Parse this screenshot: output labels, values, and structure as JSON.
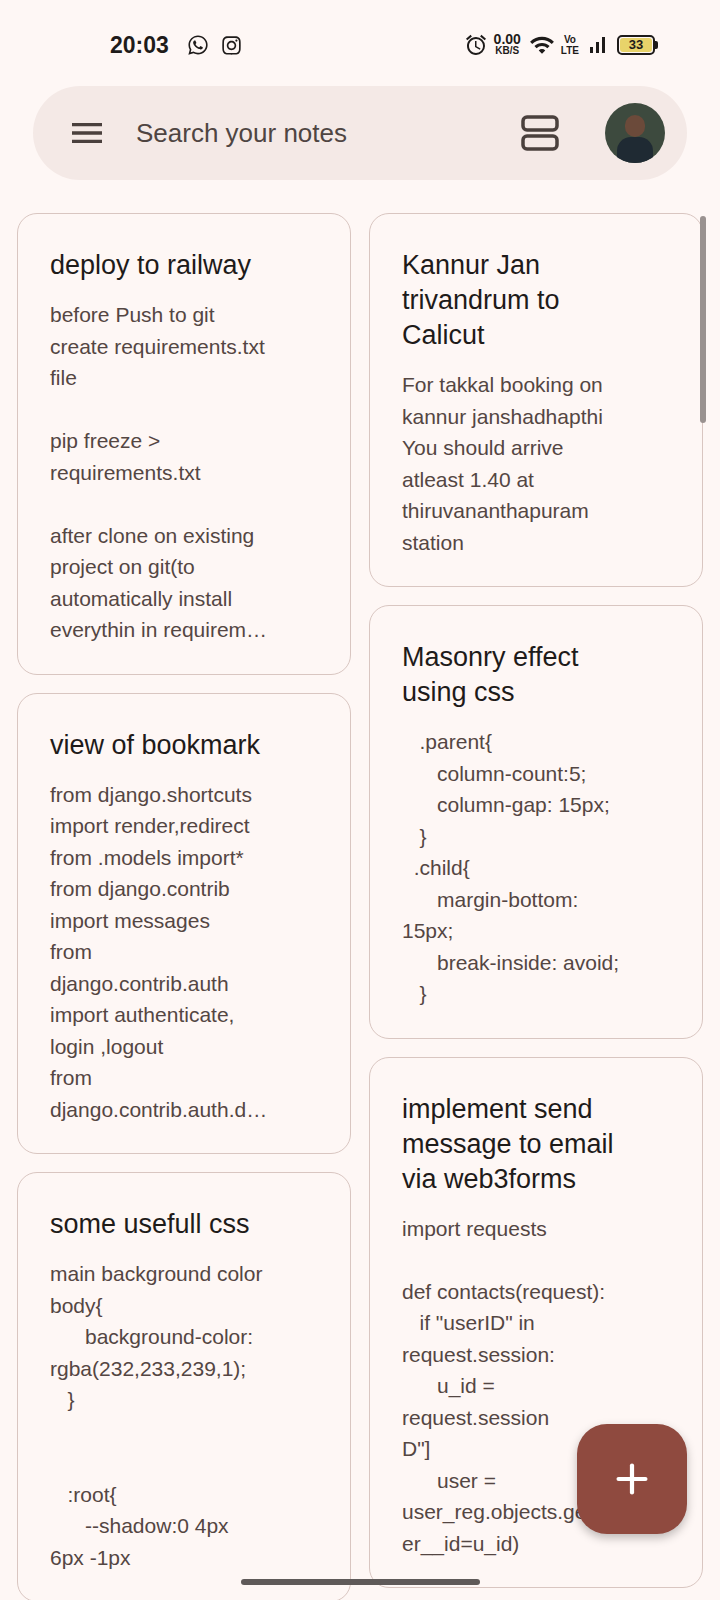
{
  "status_bar": {
    "time": "20:03",
    "network_speed": "0.00",
    "network_speed_unit": "KB/S",
    "volte": [
      "Vo",
      "LTE"
    ],
    "battery": "33"
  },
  "search": {
    "placeholder": "Search your notes"
  },
  "columns": [
    {
      "notes": [
        {
          "title": [
            "deploy to railway"
          ],
          "body": [
            "before Push to git",
            "create requirements.txt",
            "file",
            "",
            "pip freeze >",
            "requirements.txt",
            "",
            "after clone on existing",
            "project on git(to",
            "automatically install",
            "everythin in requirem…"
          ]
        },
        {
          "title": [
            "view of bookmark"
          ],
          "body": [
            "from django.shortcuts",
            "import render,redirect",
            "from .models import*",
            "from django.contrib",
            "import messages",
            "from",
            "django.contrib.auth",
            "import authenticate,",
            "login ,logout",
            "from",
            "django.contrib.auth.d…"
          ]
        },
        {
          "title": [
            "some usefull css"
          ],
          "body": [
            "main background color",
            "body{",
            "      background-color:",
            "rgba(232,233,239,1);",
            "   }",
            "",
            "",
            "   :root{",
            "      --shadow:0 4px",
            "6px -1px"
          ]
        }
      ]
    },
    {
      "notes": [
        {
          "title": [
            "Kannur Jan",
            "trivandrum to",
            "Calicut"
          ],
          "body": [
            "For takkal booking on",
            "kannur janshadhapthi",
            "You should arrive",
            "atleast 1.40 at",
            "thiruvananthapuram",
            "station"
          ]
        },
        {
          "title": [
            "Masonry effect",
            "using css"
          ],
          "body": [
            "   .parent{",
            "      column-count:5;",
            "      column-gap: 15px;",
            "   }",
            "  .child{",
            "      margin-bottom:",
            "15px;",
            "      break-inside: avoid;",
            "   }"
          ]
        },
        {
          "title": [
            "implement send",
            "message to email",
            "via web3forms"
          ],
          "body": [
            "import requests",
            "",
            "def contacts(request):",
            "   if \"userID\" in",
            "request.session:",
            "      u_id =",
            "request.session",
            "D\"]",
            "      user =",
            "user_reg.objects.get(us",
            "er__id=u_id)"
          ]
        }
      ]
    }
  ]
}
